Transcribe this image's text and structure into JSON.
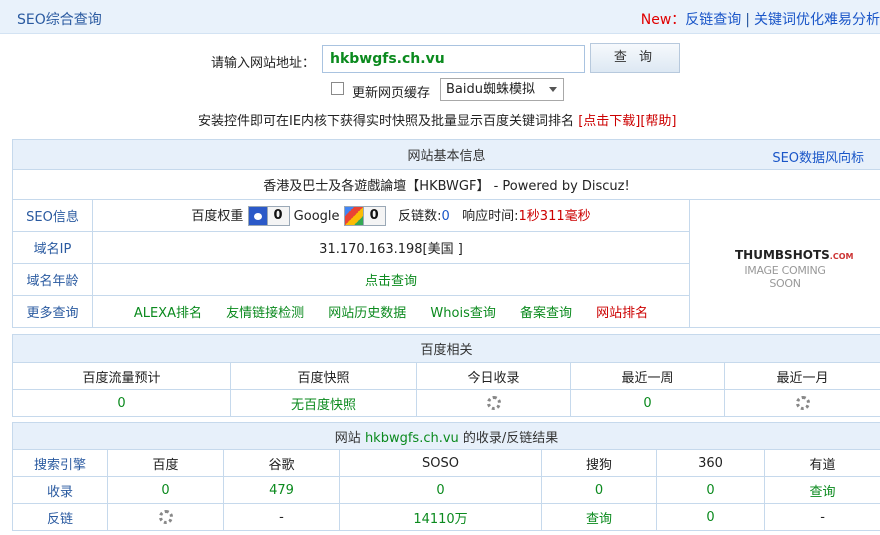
{
  "header": {
    "title": "SEO综合查询",
    "new_label": "New：",
    "link_backlinks": "反链查询",
    "separator": "|",
    "link_keyword": "关键词优化难易分析"
  },
  "search": {
    "url_label": "请输入网站地址：",
    "url_value": "hkbwgfs.ch.vu",
    "query_button": "查 询",
    "cache_label": "更新网页缓存",
    "engine_selected": "Baidu蜘蛛模拟",
    "install_text": "安装控件即可在IE内核下获得实时快照及批量显示百度关键词排名",
    "download_link": "[点击下载]",
    "help_link": "[帮助]"
  },
  "site_info": {
    "header": "网站基本信息",
    "trend_link": "SEO数据风向标",
    "site_title": "香港及巴士及各遊戲論壇【HKBWGF】 - Powered by Discuz!",
    "rows": {
      "seo_label": "SEO信息",
      "baidu_weight_label": "百度权重",
      "baidu_weight_value": "0",
      "google_label": "Google",
      "google_value": "0",
      "backlinks_label": "反链数:",
      "backlinks_value": "0",
      "response_label": "响应时间:",
      "response_value": "1秒311毫秒",
      "ip_label": "域名IP",
      "ip_value": "31.170.163.198[美国 ]",
      "age_label": "域名年龄",
      "age_value": "点击查询",
      "more_label": "更多查询",
      "more_links": [
        "ALEXA排名",
        "友情链接检测",
        "网站历史数据",
        "Whois查询",
        "备案查询",
        "网站排名"
      ]
    },
    "thumbshots_logo": "THUMBSHOTS",
    "thumbshots_suffix": ".COM",
    "thumbshots_sub": "IMAGE COMING SOON"
  },
  "baidu": {
    "header": "百度相关",
    "columns": [
      "百度流量预计",
      "百度快照",
      "今日收录",
      "最近一周",
      "最近一月"
    ],
    "values": [
      "0",
      "无百度快照",
      "",
      "0",
      ""
    ]
  },
  "results": {
    "header_prefix": "网站",
    "header_domain": "hkbwgfs.ch.vu",
    "header_suffix": "的收录/反链结果",
    "columns": [
      "搜索引擎",
      "百度",
      "谷歌",
      "SOSO",
      "搜狗",
      "360",
      "有道"
    ],
    "indexed_label": "收录",
    "indexed": [
      "0",
      "479",
      "0",
      "0",
      "0",
      "查询"
    ],
    "backlinks_label": "反链",
    "backlinks": [
      "",
      "-",
      "14110万",
      "查询",
      "0",
      "-"
    ]
  }
}
